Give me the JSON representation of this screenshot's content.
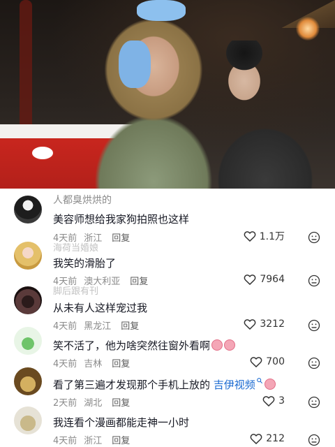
{
  "comments": [
    {
      "username": "人都臭烘烘的",
      "text": "美容师想给我家狗拍照也这样",
      "time": "4天前",
      "location": "浙江",
      "reply": "回复",
      "likes": "1.1万"
    },
    {
      "username": "海荷当婚娘",
      "text": "我笑的滑胎了",
      "time": "4天前",
      "location": "澳大利亚",
      "reply": "回复",
      "likes": "7964"
    },
    {
      "username": "脚后跟有刊",
      "text": "从未有人这样宠过我",
      "time": "4天前",
      "location": "黑龙江",
      "reply": "回复",
      "likes": "3212"
    },
    {
      "username": "",
      "text": "笑不活了，他为啥突然往窗外看啊",
      "time": "4天前",
      "location": "吉林",
      "reply": "回复",
      "likes": "700"
    },
    {
      "username": "",
      "text_before_link": "看了第三遍才发现那个手机上放的",
      "link": "吉伊视频",
      "time": "2天前",
      "location": "湖北",
      "reply": "回复",
      "likes": "3"
    },
    {
      "username": "",
      "text": "我连看个漫画都能走神一小时",
      "time": "4天前",
      "location": "浙江",
      "reply": "回复",
      "likes": "212"
    }
  ],
  "icons": {
    "like": "heart-outline-icon",
    "dislike": "dislike-face-icon",
    "search": "search-icon",
    "emoji": "crying-laughing-emoji"
  },
  "colors": {
    "text": "#161823",
    "meta": "#8a8a8a",
    "link": "#1a6ad1"
  }
}
